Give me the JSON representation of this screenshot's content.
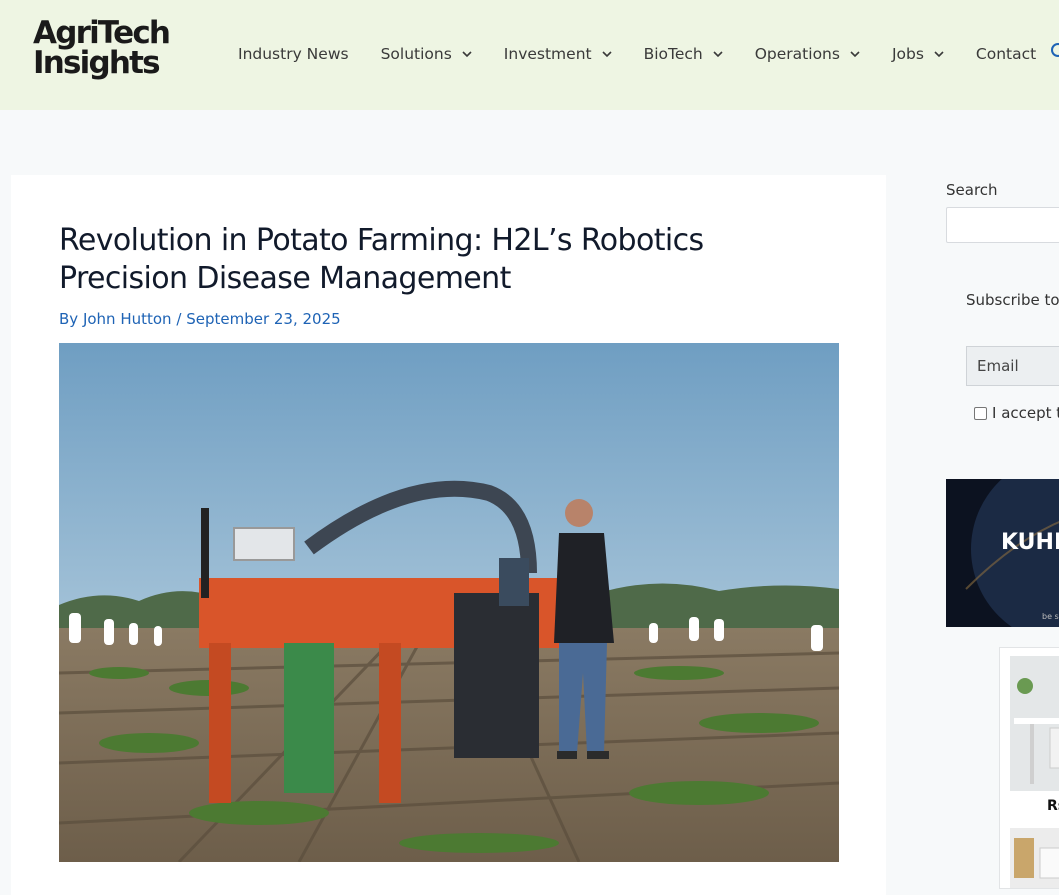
{
  "site": {
    "logo_line1": "AgriTech",
    "logo_line2": "Insights"
  },
  "nav": {
    "items": [
      {
        "label": "Industry News",
        "has_dropdown": false
      },
      {
        "label": "Solutions",
        "has_dropdown": true
      },
      {
        "label": "Investment",
        "has_dropdown": true
      },
      {
        "label": "BioTech",
        "has_dropdown": true
      },
      {
        "label": "Operations",
        "has_dropdown": true
      },
      {
        "label": "Jobs",
        "has_dropdown": true
      },
      {
        "label": "Contact",
        "has_dropdown": false
      }
    ],
    "search_icon": "search-icon"
  },
  "article": {
    "title": "Revolution in Potato Farming: H2L’s Robotics Precision Disease Management",
    "by": "By",
    "author": "John Hutton",
    "separator": "/",
    "date": "September 23, 2025"
  },
  "sidebar": {
    "search_label": "Search",
    "search_value": "",
    "subscribe_text": "Subscribe to",
    "email_placeholder": "Email",
    "consent_text": "I accept t",
    "ad_banner_text": "KUHN",
    "ad_banner_small": "be s",
    "ad_caption": "Rs"
  },
  "colors": {
    "header_bg": "#eef5e3",
    "link_blue": "#1e63b5",
    "title_navy": "#111a2b",
    "page_bg": "#f7f9fa"
  }
}
